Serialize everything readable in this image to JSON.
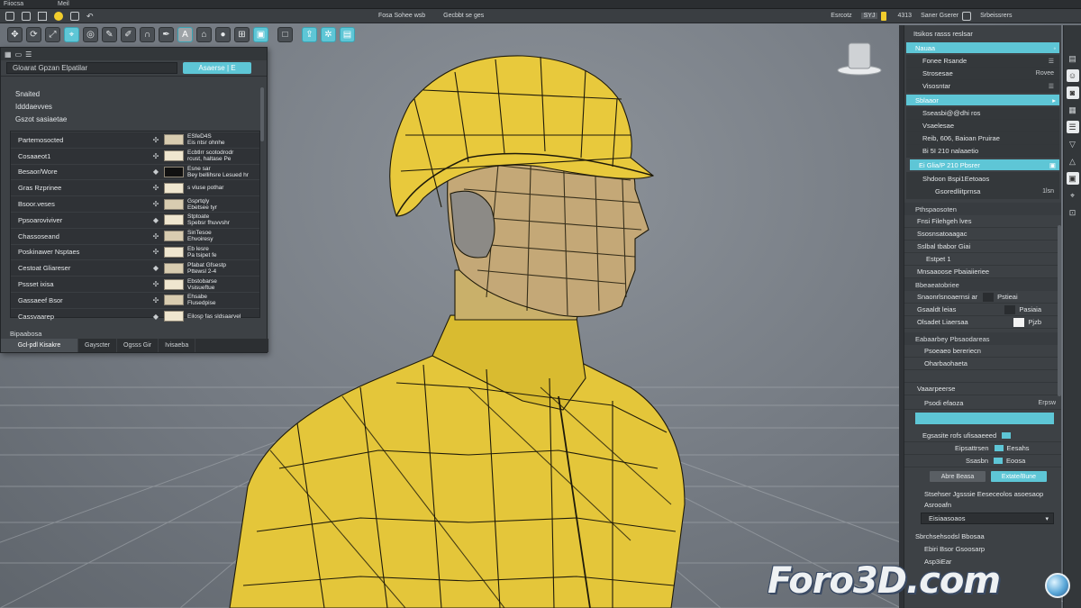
{
  "titlebar": {
    "app": "Fiiocsa",
    "menu": [
      "Meil"
    ]
  },
  "topbar": {
    "center_left": "Fosa Sohee wsb",
    "center_right": "Gecbbt se ges",
    "right_a": "Esrcotz",
    "right_b": "SYJ",
    "right_c": "4313",
    "right_d": "Saner Gserer",
    "right_e": "Srbeissrers"
  },
  "toolbar": {
    "tool_text_label": "A"
  },
  "left_panel": {
    "title": "Gloarat Gpzan Elpatilar",
    "button": "Asaerse | E",
    "tree": [
      "Snaited",
      "Idddaevves",
      "Gszot sasiaetae"
    ],
    "rows": [
      {
        "name": "Partemosocted",
        "desc": [
          "ESfeD4S",
          "Eis ntsr ohnhe"
        ]
      },
      {
        "name": "Cosaaeot1",
        "desc": [
          "Ecbtlrr scotodrodr",
          "rcust, haltase Pe"
        ]
      },
      {
        "name": "Besaor/Wore",
        "desc": [
          "Esne sar",
          "Bey bellihsre Lesued hr"
        ]
      },
      {
        "name": "Gras Rzprinee",
        "desc": [
          "s vluse pothar"
        ]
      },
      {
        "name": "Bsoor.veses",
        "desc": [
          "Gsprtqly",
          "Ebetsee tyr"
        ]
      },
      {
        "name": "Ppsoaroviviver",
        "desc": [
          "Stptoate",
          "Spebsr fhuvvshr"
        ]
      },
      {
        "name": "Chassoseand",
        "desc": [
          "SinTesoe",
          "Ehvoiresy"
        ]
      },
      {
        "name": "Poskinawer Nsptaes",
        "desc": [
          "Eb lesre",
          "Pa tsipet fe"
        ]
      },
      {
        "name": "Cestoat Gliareser",
        "desc": [
          "Pfabat Gfsestp",
          "Pttewsl 2-4"
        ]
      },
      {
        "name": "Pssset ixisa",
        "desc": [
          "Ebstobarse",
          "Vsisueftue"
        ]
      },
      {
        "name": "Gassaeef Bsor",
        "desc": [
          "Ehsabe",
          "Flusedpise"
        ]
      },
      {
        "name": "Cassvaarep",
        "desc": [
          "Eilosp fas sldsaarvel"
        ]
      }
    ],
    "section_label": "Bipaabosa",
    "tabs": [
      "Gcl-pdl Kisakre",
      "Gayscter",
      "Ogsss Gir",
      "Ivisaeba"
    ]
  },
  "right_panel": {
    "header": "Itsikos rasss reslsar",
    "teal1": "Nauaa",
    "g1": [
      {
        "label": "Fonee Rsande",
        "right": "☰"
      },
      {
        "label": "Strosesae",
        "right": "Rovee"
      },
      {
        "label": "Visosntar",
        "right": "☰"
      }
    ],
    "teal2": "Sblaaor",
    "g2": [
      "Sseasbi@@dhi ros",
      "Vsaelesae",
      "Reib, 606, Baioan Pruirae",
      "Bi 5I 210 nalaaetio"
    ],
    "teal3": "Ei Glia/P 210 Pbsrer",
    "g3_label": "Shdoon Bspi1Eetoaos",
    "g3_sub": "Gsoredliitprnsa",
    "g3_right": "1lsn",
    "sect_a": "Pthspaosoten",
    "list_a": [
      "Fnsi Filehgeh lves",
      "Ssosnsatoaagac",
      "Sslbal tbabor Giai",
      "Estpet 1",
      "Mnsaaoose Pbaiaiieriee"
    ],
    "sect_b": "Bbeaeatobriee",
    "swatches": [
      {
        "label": "Snaonrlsnoaernsi ar",
        "right": "Pstieai"
      },
      {
        "label": "Gsaaldt leias",
        "right": "Pasiaia"
      },
      {
        "label": "Olsadet Liaersaa",
        "right": "Pjzb"
      }
    ],
    "sect_c": "Eabaarbey Pbsaodareas",
    "list_c": [
      "Psoeaeo bereriecn",
      "Oharbaohaeta"
    ],
    "sect_d": "Vaaarpeerse",
    "bar_label": "Psodi efaoza",
    "bar_right": "Erpsw",
    "chip_rows": [
      {
        "label": "Egsasite rofs ufisaaeeed",
        "right": ""
      },
      {
        "label": "Eipsattrsen",
        "right": "Eesahs"
      },
      {
        "label": "Ssasbn",
        "right": "Eoosa"
      }
    ],
    "btn_gray": "Abre Beasa",
    "btn_teal": "Extate/Bune",
    "line_a": "Stsehser Jgsssie Eeseceolos asoesaop",
    "line_b": "Asrooafn",
    "dropdown": "Eisiaasoaos",
    "line_c": "Sbrchsehsodsl Bbosaa",
    "line_d": "Ebiri Bsor Gsoosarp",
    "line_e": "Asp3iEar"
  },
  "watermark": {
    "text": "Foro3D.com"
  }
}
